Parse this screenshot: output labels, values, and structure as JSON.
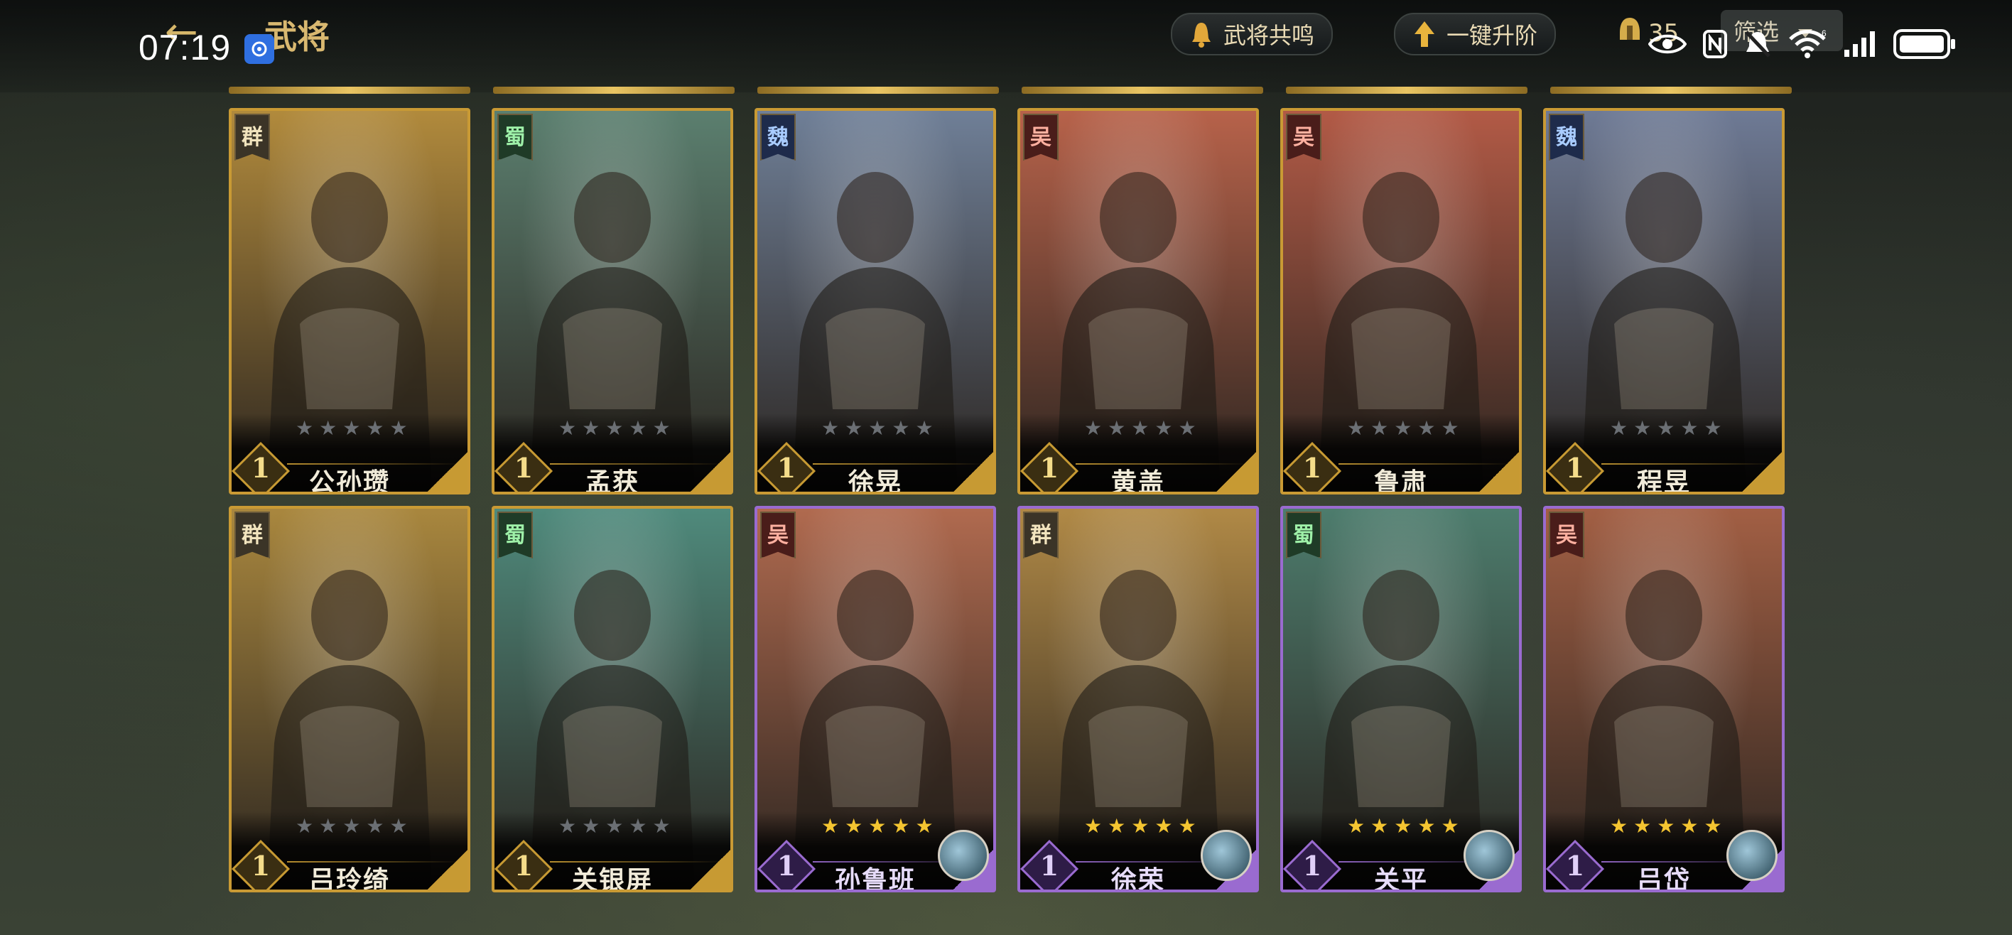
{
  "status_bar": {
    "time": "07:19",
    "notification_icon": "app-badge-icon",
    "icons": [
      "eye-icon",
      "nfc-icon",
      "dnd-icon",
      "wifi-icon",
      "signal-icon",
      "battery-icon"
    ],
    "wifi_label": "6"
  },
  "header": {
    "title": "武将",
    "back_icon": "back-arrow-icon",
    "resonance_label": "武将共鸣",
    "upgrade_label": "一键升阶",
    "resource_count": "35",
    "filter_label": "筛选"
  },
  "colors": {
    "gold_frame": "#c79a33",
    "purple_frame": "#9a6bd0",
    "star_on": "#f4c531",
    "star_off": "#6b6f74"
  },
  "generals": [
    {
      "name": "公孙瓒",
      "faction": "群",
      "level": "1",
      "stars_filled": 0,
      "stars_total": 5,
      "rarity": "gold",
      "tone": "#b18a3c"
    },
    {
      "name": "孟获",
      "faction": "蜀",
      "level": "1",
      "stars_filled": 0,
      "stars_total": 5,
      "rarity": "gold",
      "tone": "#5b7f6f"
    },
    {
      "name": "徐晃",
      "faction": "魏",
      "level": "1",
      "stars_filled": 0,
      "stars_total": 5,
      "rarity": "gold",
      "tone": "#6f7f97"
    },
    {
      "name": "黄盖",
      "faction": "吴",
      "level": "1",
      "stars_filled": 0,
      "stars_total": 5,
      "rarity": "gold",
      "tone": "#b7624a"
    },
    {
      "name": "鲁肃",
      "faction": "吴",
      "level": "1",
      "stars_filled": 0,
      "stars_total": 5,
      "rarity": "gold",
      "tone": "#b25a46"
    },
    {
      "name": "程昱",
      "faction": "魏",
      "level": "1",
      "stars_filled": 0,
      "stars_total": 5,
      "rarity": "gold",
      "tone": "#6e7a95"
    },
    {
      "name": "吕玲绮",
      "faction": "群",
      "level": "1",
      "stars_filled": 0,
      "stars_total": 5,
      "rarity": "gold",
      "tone": "#a9873e"
    },
    {
      "name": "关银屏",
      "faction": "蜀",
      "level": "1",
      "stars_filled": 0,
      "stars_total": 5,
      "rarity": "gold",
      "tone": "#4f8a7c"
    },
    {
      "name": "孙鲁班",
      "faction": "吴",
      "level": "1",
      "stars_filled": 5,
      "stars_total": 5,
      "rarity": "purple",
      "tone": "#b06a4f",
      "skill_icon": "lightning-skill-icon"
    },
    {
      "name": "徐荣",
      "faction": "群",
      "level": "1",
      "stars_filled": 5,
      "stars_total": 5,
      "rarity": "purple",
      "tone": "#b08946",
      "skill_icon": "frost-skill-icon"
    },
    {
      "name": "关平",
      "faction": "蜀",
      "level": "1",
      "stars_filled": 5,
      "stars_total": 5,
      "rarity": "purple",
      "tone": "#4d7c6d",
      "skill_icon": "sword-skill-icon"
    },
    {
      "name": "吕岱",
      "faction": "吴",
      "level": "1",
      "stars_filled": 5,
      "stars_total": 5,
      "rarity": "purple",
      "tone": "#a25f44",
      "skill_icon": "coin-skill-icon"
    }
  ]
}
